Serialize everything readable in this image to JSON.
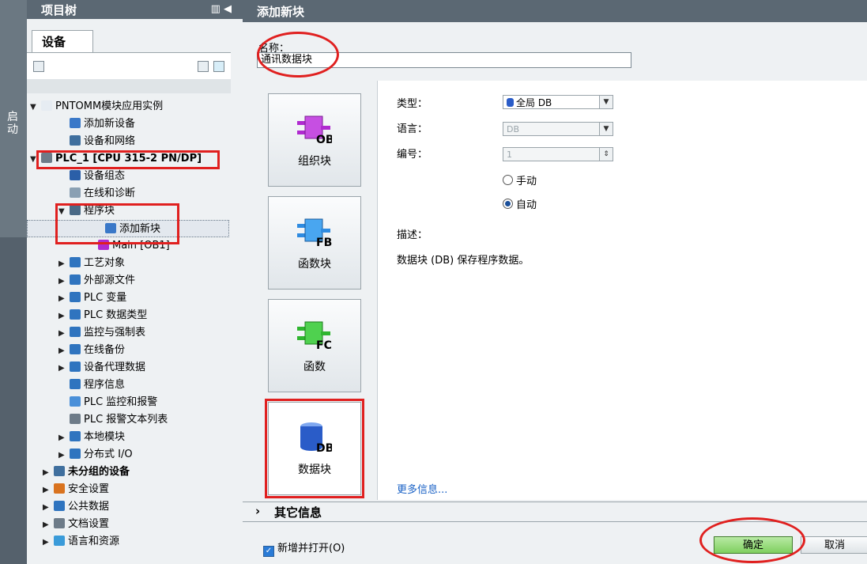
{
  "sidebar_strip": {
    "label": "启动"
  },
  "tree": {
    "title": "项目树",
    "tab": "设备",
    "items": [
      {
        "label": "PNTOMM模块应用实例",
        "toggle": "▼",
        "icon": "project-icon",
        "color": "#e6ecf2"
      },
      {
        "label": "添加新设备",
        "toggle": "",
        "icon": "add-device-icon",
        "color": "#3a78c8"
      },
      {
        "label": "设备和网络",
        "toggle": "",
        "icon": "network-icon",
        "color": "#3f6f9e"
      },
      {
        "label": "PLC_1 [CPU 315-2 PN/DP]",
        "toggle": "▼",
        "icon": "plc-icon",
        "color": "#6d7b88"
      },
      {
        "label": "设备组态",
        "toggle": "",
        "icon": "device-config-icon",
        "color": "#2b5fa8"
      },
      {
        "label": "在线和诊断",
        "toggle": "",
        "icon": "diagnostics-icon",
        "color": "#8aa0b3"
      },
      {
        "label": "程序块",
        "toggle": "▼",
        "icon": "program-blocks-icon",
        "color": "#4a6a86"
      },
      {
        "label": "添加新块",
        "toggle": "",
        "icon": "add-block-icon",
        "color": "#3a78c8"
      },
      {
        "label": "Main [OB1]",
        "toggle": "",
        "icon": "ob-block-icon",
        "color": "#b02ad0"
      },
      {
        "label": "工艺对象",
        "toggle": "▶",
        "icon": "technology-icon",
        "color": "#2f74bf"
      },
      {
        "label": "外部源文件",
        "toggle": "▶",
        "icon": "source-file-icon",
        "color": "#2f74bf"
      },
      {
        "label": "PLC 变量",
        "toggle": "▶",
        "icon": "plc-tags-icon",
        "color": "#2f74bf"
      },
      {
        "label": "PLC 数据类型",
        "toggle": "▶",
        "icon": "data-types-icon",
        "color": "#2f74bf"
      },
      {
        "label": "监控与强制表",
        "toggle": "▶",
        "icon": "watch-table-icon",
        "color": "#2f74bf"
      },
      {
        "label": "在线备份",
        "toggle": "▶",
        "icon": "backup-icon",
        "color": "#2f74bf"
      },
      {
        "label": "设备代理数据",
        "toggle": "▶",
        "icon": "proxy-data-icon",
        "color": "#2f74bf"
      },
      {
        "label": "程序信息",
        "toggle": "",
        "icon": "program-info-icon",
        "color": "#2f74bf"
      },
      {
        "label": "PLC 监控和报警",
        "toggle": "",
        "icon": "alarm-icon",
        "color": "#4a90d9"
      },
      {
        "label": "PLC 报警文本列表",
        "toggle": "",
        "icon": "text-list-icon",
        "color": "#6d7b88"
      },
      {
        "label": "本地模块",
        "toggle": "▶",
        "icon": "local-modules-icon",
        "color": "#2f74bf"
      },
      {
        "label": "分布式 I/O",
        "toggle": "▶",
        "icon": "distributed-io-icon",
        "color": "#2f74bf"
      },
      {
        "label": "未分组的设备",
        "toggle": "▶",
        "icon": "ungrouped-devices-icon",
        "color": "#3f6f9e"
      },
      {
        "label": "安全设置",
        "toggle": "▶",
        "icon": "security-icon",
        "color": "#d9731f"
      },
      {
        "label": "公共数据",
        "toggle": "▶",
        "icon": "common-data-icon",
        "color": "#2f74bf"
      },
      {
        "label": "文档设置",
        "toggle": "▶",
        "icon": "document-settings-icon",
        "color": "#6d7b88"
      },
      {
        "label": "语言和资源",
        "toggle": "▶",
        "icon": "languages-icon",
        "color": "#3a9bd9"
      }
    ]
  },
  "dialog": {
    "title": "添加新块",
    "name_label": "名称：",
    "name_value": "通讯数据块",
    "blocks": [
      {
        "label": "组织块",
        "code": "OB",
        "color": "#b02ad0"
      },
      {
        "label": "函数块",
        "code": "FB",
        "color": "#2f8be0"
      },
      {
        "label": "函数",
        "code": "FC",
        "color": "#2fb52f"
      },
      {
        "label": "数据块",
        "code": "DB",
        "color": "#2a5cc8"
      }
    ],
    "type_label": "类型：",
    "type_value": "全局 DB",
    "language_label": "语言：",
    "language_value": "DB",
    "number_label": "编号：",
    "number_value": "1",
    "manual_label": "手动",
    "auto_label": "自动",
    "description_label": "描述：",
    "description_text": "数据块 (DB) 保存程序数据。",
    "more_info": "更多信息...",
    "other_info": "其它信息",
    "open_checkbox": "新增并打开(O)",
    "ok": "确定",
    "cancel": "取消"
  }
}
